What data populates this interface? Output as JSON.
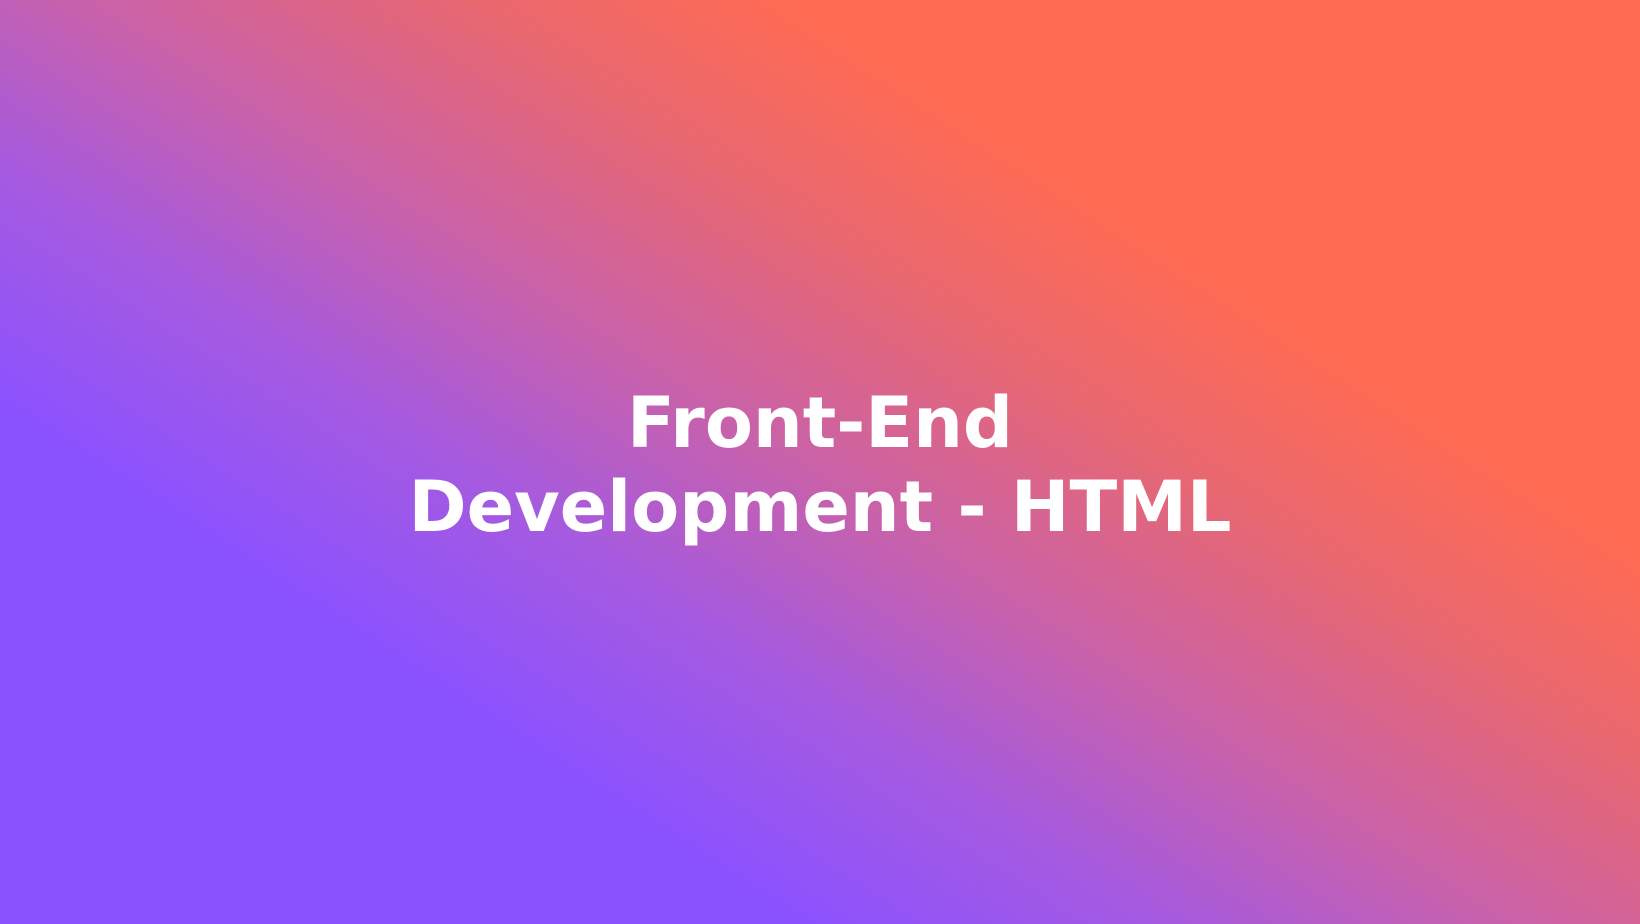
{
  "slide": {
    "title_line_1": "Front-End",
    "title_line_2": "Development - HTML"
  },
  "colors": {
    "gradient_start": "#8b52ff",
    "gradient_end": "#ff6b53",
    "text": "#ffffff"
  }
}
